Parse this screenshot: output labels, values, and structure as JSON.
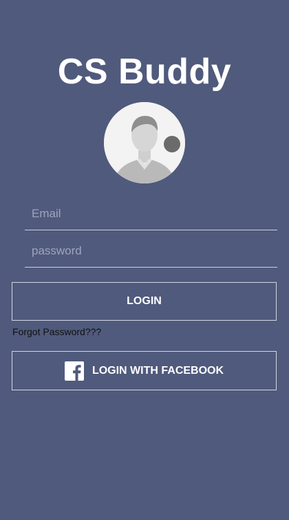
{
  "app": {
    "title": "CS Buddy"
  },
  "form": {
    "email_placeholder": "Email",
    "email_value": "",
    "password_placeholder": "password",
    "password_value": ""
  },
  "actions": {
    "login_label": "LOGIN",
    "forgot_label": "Forgot Password???",
    "facebook_label": "LOGIN WITH FACEBOOK"
  },
  "icons": {
    "avatar": "user-avatar-icon",
    "avatar_badge": "badge-dot-icon",
    "facebook": "facebook-icon"
  },
  "colors": {
    "background": "#505a7c",
    "text": "#ffffff",
    "placeholder": "#9da4be",
    "border": "#d3d7e6",
    "link": "#111111"
  }
}
